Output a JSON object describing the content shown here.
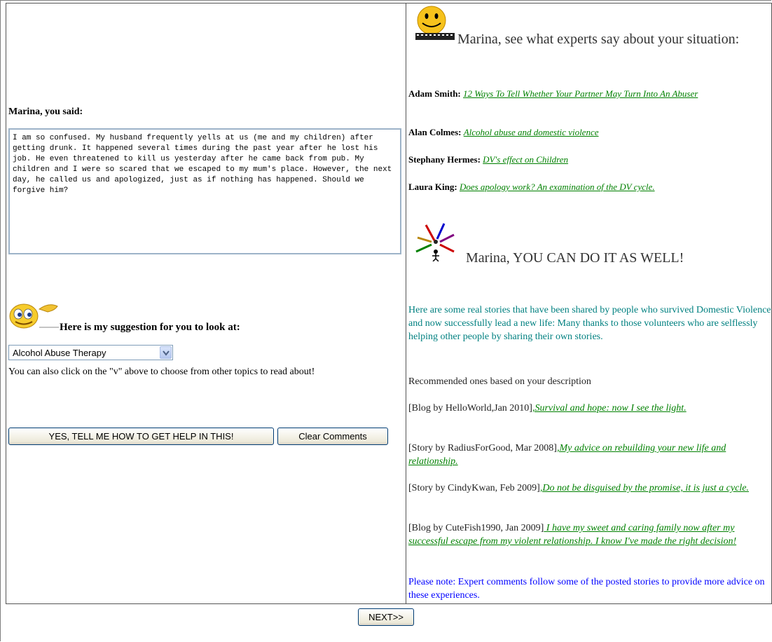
{
  "left": {
    "you_said_label": "Marina, you said:",
    "comment_text": "I am so confused. My husband frequently yells at us (me and my children) after getting drunk. It happened several times during the past year after he lost his job. He even threatened to kill us yesterday after he came back from pub. My children and I were so scared that we escaped to my mum's place. However, the next day, he called us and apologized, just as if nothing has happened. Should we forgive him?",
    "suggestion_label": "Here is my suggestion for you to look at:",
    "topic_select_value": "Alcohol Abuse Therapy",
    "also_text": "You can also click on the \"v\" above to choose from other topics to read about!",
    "yes_button_label": "YES, TELL ME HOW TO GET HELP IN THIS!",
    "clear_button_label": "Clear Comments"
  },
  "right": {
    "experts_heading": "Marina, see what experts say about your situation:",
    "experts": [
      {
        "name": "Adam Smith:",
        "link": "12 Ways To Tell Whether Your Partner May Turn Into An Abuser"
      },
      {
        "name": "Alan Colmes:",
        "link": "Alcohol abuse and domestic violence"
      },
      {
        "name": "Stephany Hermes:",
        "link": "DV's effect on Children"
      },
      {
        "name": "Laura King:",
        "link": "Does apology work? An examination of the DV cycle."
      }
    ],
    "cando_heading": "Marina, YOU CAN DO IT AS WELL!",
    "intro_text": "Here are some real stories that have been shared by people who survived Domestic Violence and now successfully lead a new life: Many thanks to those volunteers who are selflessly helping other people by sharing their own stories.",
    "recommended_text": "Recommended ones based on your description",
    "stories": [
      {
        "source": "[Blog by HelloWorld,Jan 2010]",
        "link": ",Survival and hope: now I see the light."
      },
      {
        "source": "[Story by RadiusForGood, Mar 2008]",
        "link": ",My advice on rebuilding your new life and relationship."
      },
      {
        "source": "[Story by CindyKwan, Feb 2009]",
        "link": ",Do not be disguised by the promise, it is just a cycle."
      },
      {
        "source": "[Blog by CuteFish1990, Jan 2009]",
        "link": " I have my sweet and caring family now after my successful escape from my violent relationship. I know I've made the right decision!"
      }
    ],
    "note_text": "Please note: Expert comments follow some of the posted stories to provide more advice on these experiences."
  },
  "footer": {
    "next_button_label": "NEXT>>"
  },
  "colors": {
    "link_green": "#008000",
    "intro_teal": "#008080",
    "note_blue": "#0000ff"
  },
  "icons": {
    "smiley_icon": "smiley-film-icon",
    "wink_icon": "winking-smiley-icon",
    "people_icon": "people-circle-icon"
  }
}
